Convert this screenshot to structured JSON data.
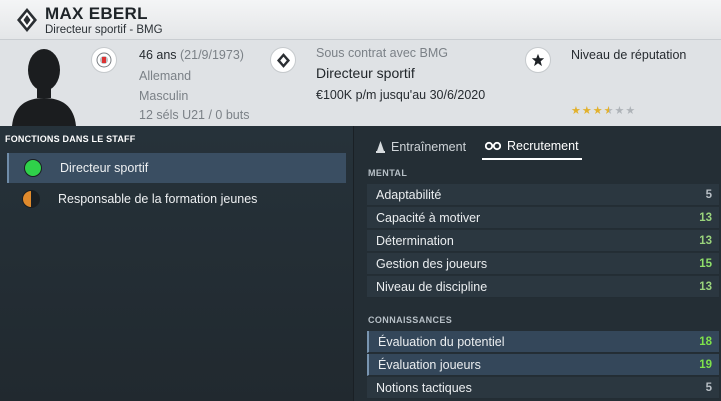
{
  "header": {
    "name": "MAX EBERL",
    "role": "Directeur sportif - BMG"
  },
  "info": {
    "age": "46 ans",
    "birthdate": "(21/9/1973)",
    "nationality": "Allemand",
    "gender": "Masculin",
    "caps": "12 séls U21 / 0 buts",
    "contract_caption": "Sous contrat avec BMG",
    "contract_role": "Directeur sportif",
    "contract_terms": "€100K p/m jusqu'au 30/6/2020",
    "reputation_label": "Niveau de réputation",
    "reputation_stars": 3.5,
    "reputation_max": 6
  },
  "staff": {
    "title": "FONCTIONS DANS LE STAFF",
    "items": [
      {
        "label": "Directeur sportif",
        "color": "#2fd14a",
        "selected": true
      },
      {
        "label": "Responsable de la formation jeunes",
        "color": "#e08a2c",
        "selected": false
      }
    ]
  },
  "tabs": [
    {
      "label": "Entraînement",
      "icon": "cone-icon",
      "active": false
    },
    {
      "label": "Recrutement",
      "icon": "binoculars-icon",
      "active": true
    }
  ],
  "mental": {
    "title": "MENTAL",
    "rows": [
      {
        "name": "Adaptabilité",
        "value": "5",
        "color": "#b8bfc5"
      },
      {
        "name": "Capacité à motiver",
        "value": "13",
        "color": "#9ad47c"
      },
      {
        "name": "Détermination",
        "value": "13",
        "color": "#9ad47c"
      },
      {
        "name": "Gestion des joueurs",
        "value": "15",
        "color": "#8fe06a"
      },
      {
        "name": "Niveau de discipline",
        "value": "13",
        "color": "#9ad47c"
      }
    ]
  },
  "knowledge": {
    "title": "CONNAISSANCES",
    "rows": [
      {
        "name": "Évaluation du potentiel",
        "value": "18",
        "color": "#7ee24a",
        "highlight": true
      },
      {
        "name": "Évaluation joueurs",
        "value": "19",
        "color": "#7ee24a",
        "highlight": true
      },
      {
        "name": "Notions tactiques",
        "value": "5",
        "color": "#b8bfc5",
        "highlight": false
      }
    ]
  }
}
